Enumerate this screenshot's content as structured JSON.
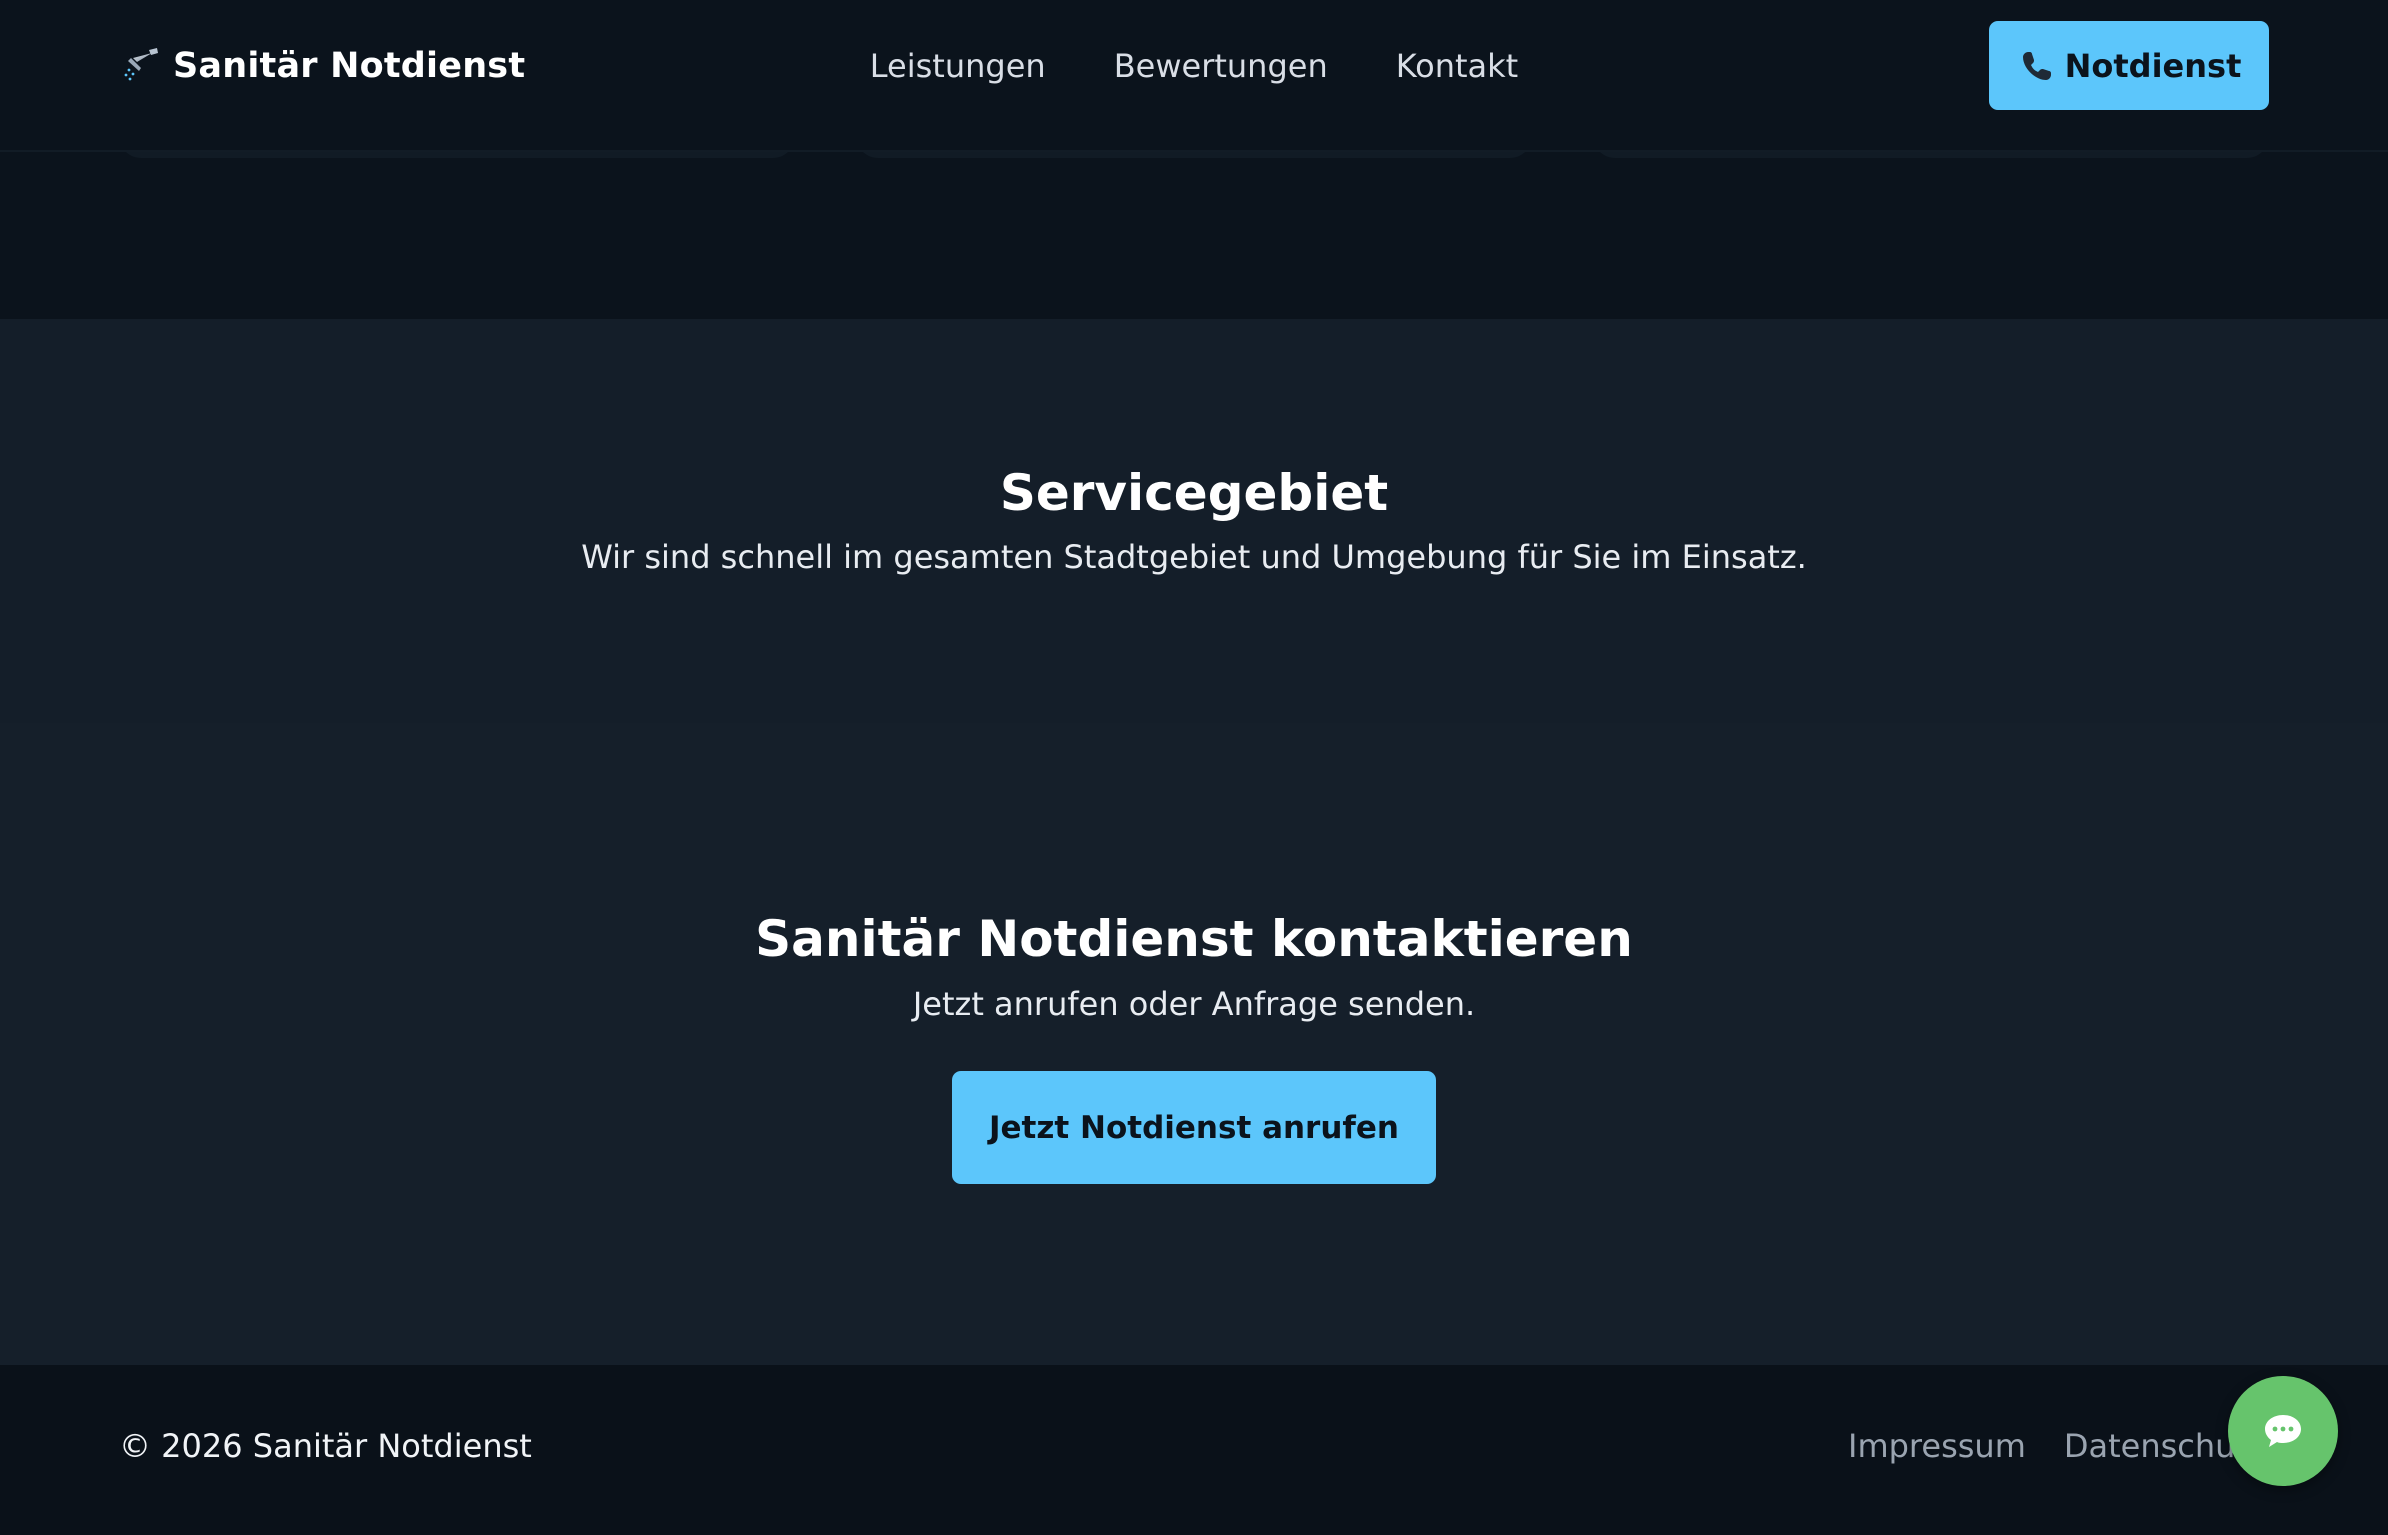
{
  "header": {
    "brand": "Sanitär Notdienst",
    "brand_icon": "shower-head-icon",
    "nav": {
      "services": "Leistungen",
      "reviews": "Bewertungen",
      "contact": "Kontakt"
    },
    "cta_label": "Notdienst",
    "cta_icon": "phone-icon"
  },
  "service_area": {
    "title": "Servicegebiet",
    "subtitle": "Wir sind schnell im gesamten Stadtgebiet und Umgebung für Sie im Einsatz."
  },
  "contact": {
    "title": "Sanitär Notdienst kontaktieren",
    "subtitle": "Jetzt anrufen oder Anfrage senden.",
    "button_label": "Jetzt Notdienst anrufen"
  },
  "footer": {
    "copyright": "© 2026 Sanitär Notdienst",
    "links": {
      "imprint": "Impressum",
      "privacy": "Datenschutz"
    }
  },
  "chat": {
    "icon": "chat-bubble-icon"
  },
  "colors": {
    "accent": "#5cc6fb",
    "background": "#0b131c",
    "section": "#141e29",
    "chat": "#66c46c"
  }
}
